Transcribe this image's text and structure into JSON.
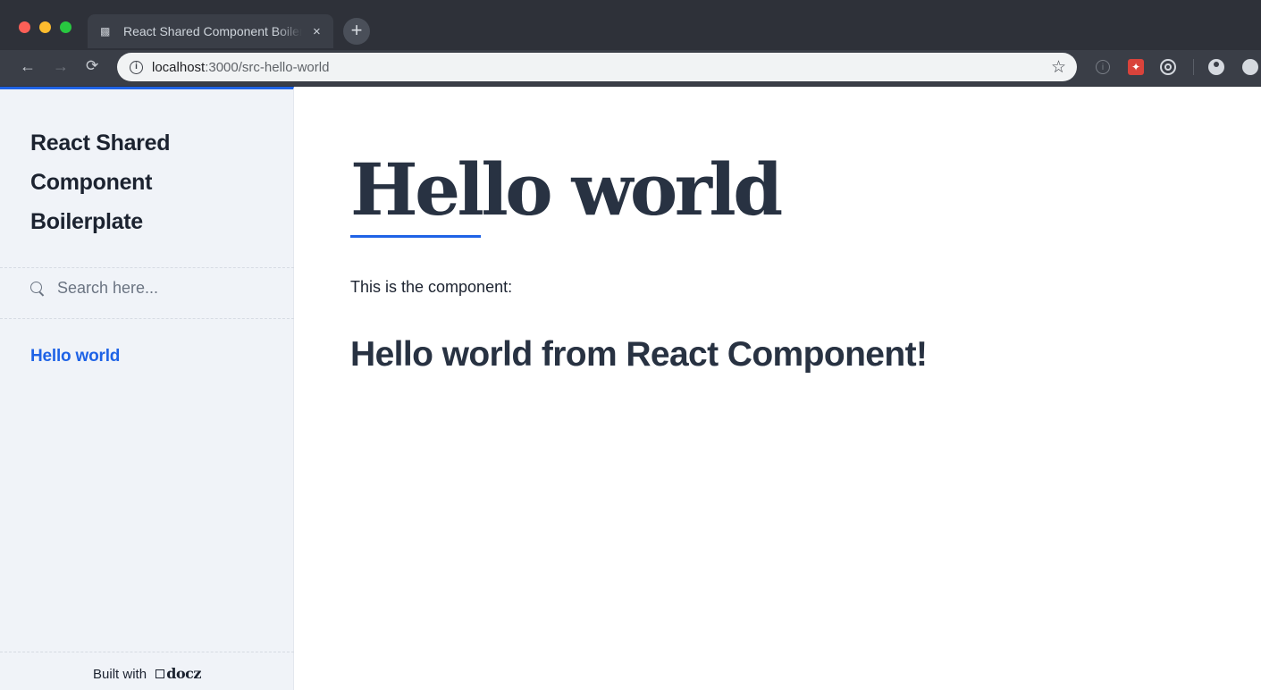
{
  "browser": {
    "tab_title": "React Shared Component Boilerplate",
    "tab_close": "×",
    "new_tab": "+",
    "url_host": "localhost",
    "url_path": ":3000/src-hello-world",
    "back_glyph": "←",
    "forward_glyph": "→",
    "reload_glyph": "C",
    "star_glyph": "☆",
    "icons": [
      "tab-favicon",
      "info-icon",
      "star-icon",
      "extension-icon",
      "account-icon"
    ]
  },
  "sidebar": {
    "brand": "React Shared Component Boilerplate",
    "search_placeholder": "Search here...",
    "nav_items": [
      {
        "label": "Hello world",
        "active": true
      }
    ],
    "footer_prefix": "Built with",
    "footer_brand": "docz"
  },
  "content": {
    "title": "Hello world",
    "paragraph": "This is the component:",
    "component_heading": "Hello world from React Component!"
  },
  "colors": {
    "accent": "#1f63e6",
    "sidebar_bg": "#f0f3f8",
    "heading": "#283242",
    "chrome_bg": "#2e3139"
  }
}
